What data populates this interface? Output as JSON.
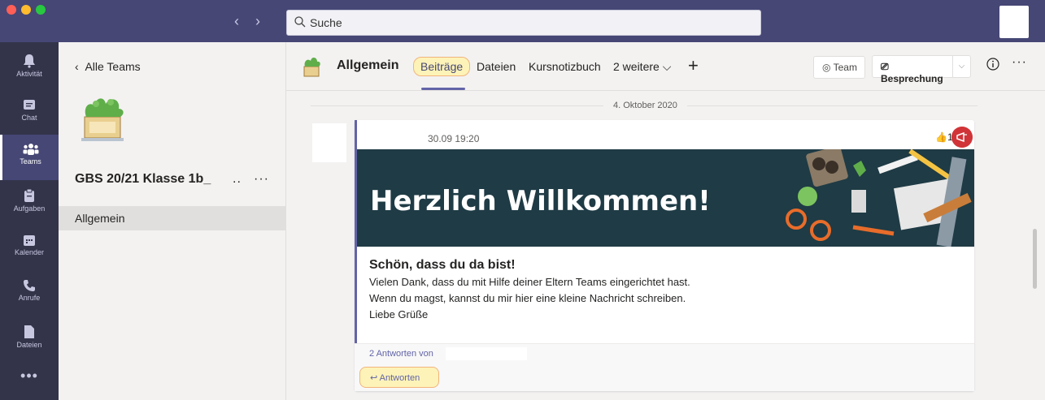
{
  "window": {
    "search_placeholder": "Suche",
    "nav_back": "‹",
    "nav_forward": "›"
  },
  "rail": {
    "items": [
      {
        "label": "Aktivität",
        "icon": "bell-icon"
      },
      {
        "label": "Chat",
        "icon": "chat-icon"
      },
      {
        "label": "Teams",
        "icon": "teams-icon"
      },
      {
        "label": "Aufgaben",
        "icon": "assignments-icon"
      },
      {
        "label": "Kalender",
        "icon": "calendar-icon"
      },
      {
        "label": "Anrufe",
        "icon": "phone-icon"
      },
      {
        "label": "Dateien",
        "icon": "file-icon"
      }
    ],
    "more": "•••"
  },
  "panel": {
    "back_label": "Alle Teams",
    "team_name": "GBS 20/21 Klasse 1b_",
    "team_name_suffix": "..",
    "team_more": "···",
    "channels": [
      "Allgemein"
    ]
  },
  "header": {
    "channel_title": "Allgemein",
    "tabs": [
      "Beiträge",
      "Dateien",
      "Kursnotizbuch",
      "2 weitere ⌵"
    ],
    "plus": "+",
    "team_button": "Team",
    "meeting_button": "Besprechung",
    "more": "···"
  },
  "feed": {
    "date_divider": "4. Oktober 2020",
    "post": {
      "timestamp": "30.09 19:20",
      "reaction_count": "1",
      "banner_title": "Herzlich Willkommen!",
      "subtitle": "Schön, dass du da bist!",
      "lines": [
        "Vielen Dank, dass du mit Hilfe deiner Eltern Teams eingerichtet hast.",
        "Wenn du magst, kannst du mir hier eine kleine Nachricht schreiben.",
        "Liebe Grüße"
      ],
      "replies": "2 Antworten von",
      "reply_button": "Antworten"
    }
  },
  "colors": {
    "titlebar": "#464775",
    "rail": "#33344a",
    "accent": "#6264a7",
    "highlight": "#fdf3b8",
    "banner": "#1f3b45",
    "alert": "#d13438"
  }
}
